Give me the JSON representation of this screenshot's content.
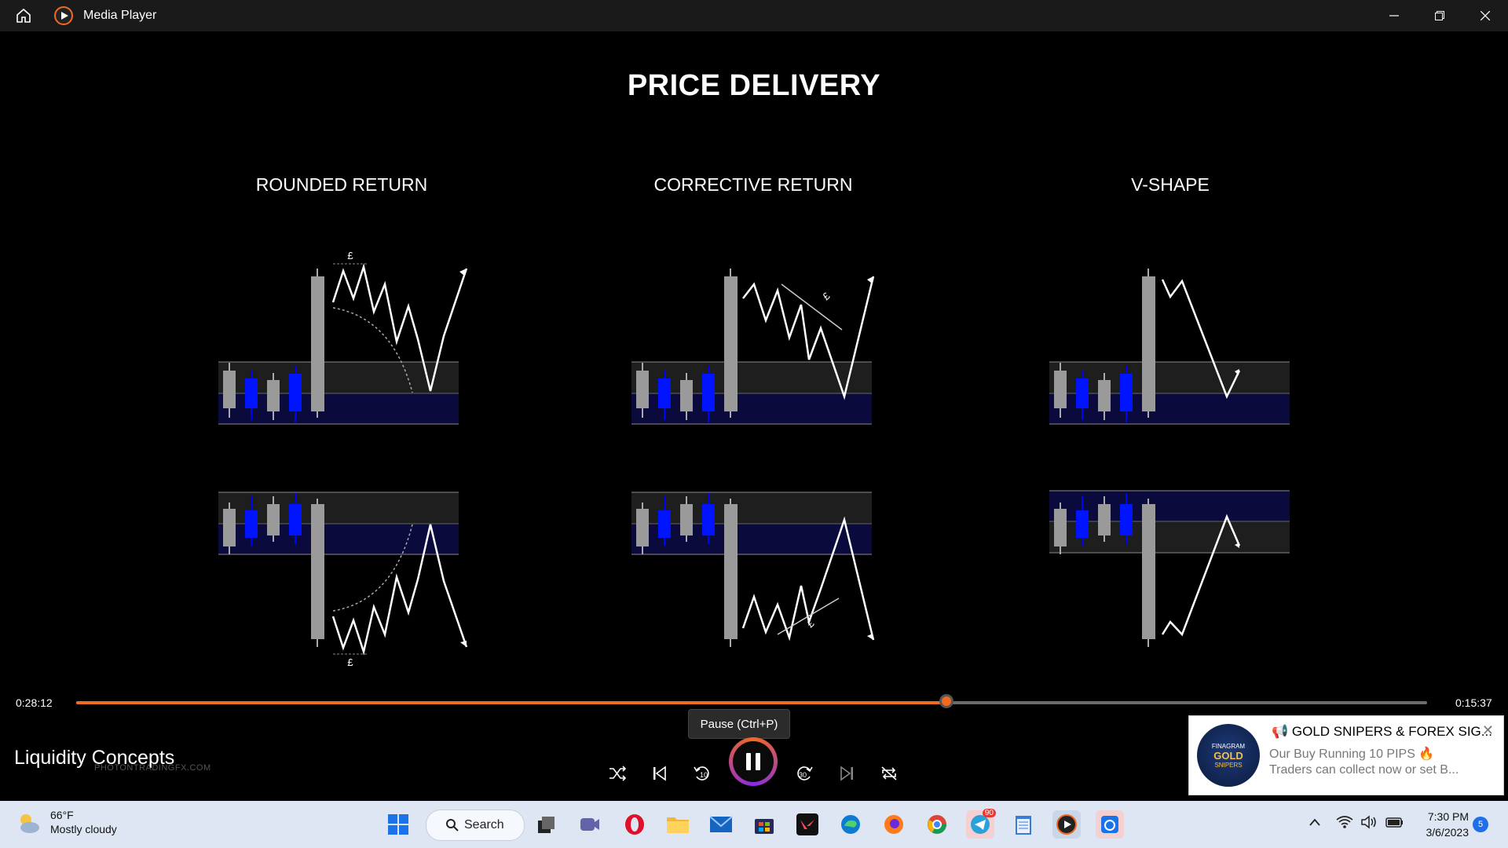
{
  "window": {
    "title": "Media Player"
  },
  "slide": {
    "title": "PRICE DELIVERY",
    "columns": [
      "ROUNDED RETURN",
      "CORRECTIVE RETURN",
      "V-SHAPE"
    ],
    "currency_mark": "£",
    "watermark": "PHOTONTRADINGFX.COM"
  },
  "player": {
    "elapsed": "0:28:12",
    "remaining": "0:15:37",
    "progress_fraction": 0.644,
    "media_title": "Liquidity Concepts",
    "tooltip": "Pause (Ctrl+P)",
    "accent": "#f26a21"
  },
  "notification": {
    "brand_top": "FINAGRAM",
    "brand_main": "GOLD",
    "brand_sub": "SNIPERS",
    "title": "📢 GOLD SNIPERS & FOREX SIG...",
    "line1": "Our Buy Running 10 PIPS 🔥",
    "line2": "Traders can collect now or set B..."
  },
  "taskbar": {
    "weather_temp": "66°F",
    "weather_desc": "Mostly cloudy",
    "search_label": "Search",
    "telegram_badge": "90",
    "time": "7:30 PM",
    "date": "3/6/2023",
    "notification_count": "5"
  }
}
